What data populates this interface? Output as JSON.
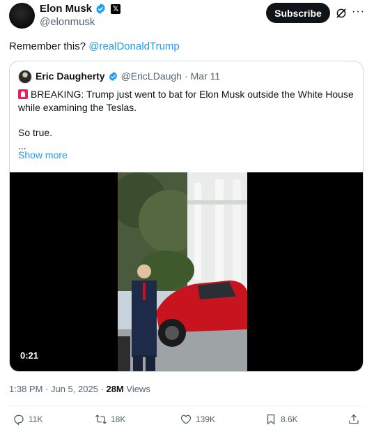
{
  "author": {
    "name": "Elon Musk",
    "handle": "@elonmusk",
    "badge_letter": "𝕏"
  },
  "header": {
    "subscribe_label": "Subscribe",
    "more_label": "···"
  },
  "tweet": {
    "text": "Remember this?",
    "mention": "@realDonaldTrump"
  },
  "quote": {
    "name": "Eric Daugherty",
    "handle": "@EricLDaugh",
    "date": "Mar 11",
    "line1": "BREAKING: Trump just went to bat for Elon Musk outside the White House",
    "line2": "while examining the Teslas.",
    "line3": "So true.",
    "line4": "...",
    "show_more": "Show more",
    "video_duration": "0:21"
  },
  "meta": {
    "time_date": "1:38 PM · Jun 5, 2025 · ",
    "views_count": "28M",
    "views_label": " Views"
  },
  "actions": {
    "replies": "11K",
    "reposts": "18K",
    "likes": "139K",
    "bookmarks": "8.6K"
  },
  "colors": {
    "accent": "#1d9bf0",
    "text": "#0f1419",
    "secondary": "#536471",
    "border": "#cfd9de"
  }
}
